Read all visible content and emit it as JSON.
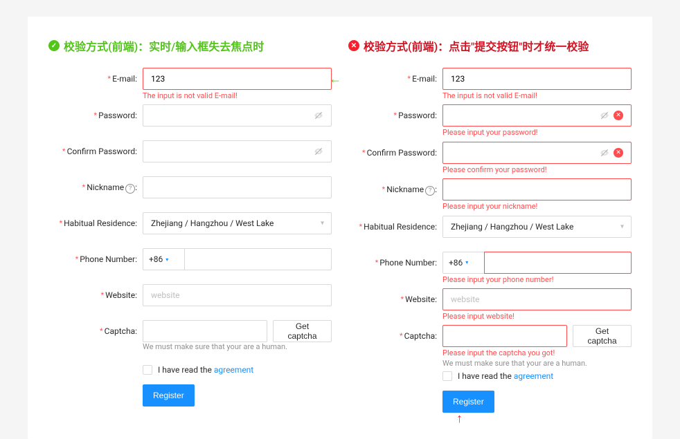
{
  "left": {
    "statusIcon": "✓",
    "title": "校验方式(前端)：实时/输入框失去焦点时",
    "email": {
      "label": "E-mail",
      "value": "123",
      "error": "The input is not valid E-mail!"
    },
    "password": {
      "label": "Password"
    },
    "confirm": {
      "label": "Confirm Password"
    },
    "nickname": {
      "label": "Nickname"
    },
    "residence": {
      "label": "Habitual Residence",
      "value": "Zhejiang / Hangzhou / West Lake"
    },
    "phone": {
      "label": "Phone Number",
      "prefix": "+86"
    },
    "website": {
      "label": "Website",
      "placeholder": "website"
    },
    "captcha": {
      "label": "Captcha",
      "btn": "Get captcha",
      "extra": "We must make sure that your are a human."
    },
    "agreementText": "I have read the ",
    "agreementLink": "agreement",
    "register": "Register"
  },
  "right": {
    "statusIcon": "✕",
    "title": "校验方式(前端)：点击\"提交按钮\"时才统一校验",
    "email": {
      "label": "E-mail",
      "value": "123",
      "error": "The input is not valid E-mail!"
    },
    "password": {
      "label": "Password",
      "error": "Please input your password!"
    },
    "confirm": {
      "label": "Confirm Password",
      "error": "Please confirm your password!"
    },
    "nickname": {
      "label": "Nickname",
      "error": "Please input your nickname!"
    },
    "residence": {
      "label": "Habitual Residence",
      "value": "Zhejiang / Hangzhou / West Lake"
    },
    "phone": {
      "label": "Phone Number",
      "prefix": "+86",
      "error": "Please input your phone number!"
    },
    "website": {
      "label": "Website",
      "placeholder": "website",
      "error": "Please input website!"
    },
    "captcha": {
      "label": "Captcha",
      "btn": "Get captcha",
      "error": "Please input the captcha you got!",
      "extra": "We must make sure that your are a human."
    },
    "agreementText": "I have read the ",
    "agreementLink": "agreement",
    "register": "Register"
  }
}
